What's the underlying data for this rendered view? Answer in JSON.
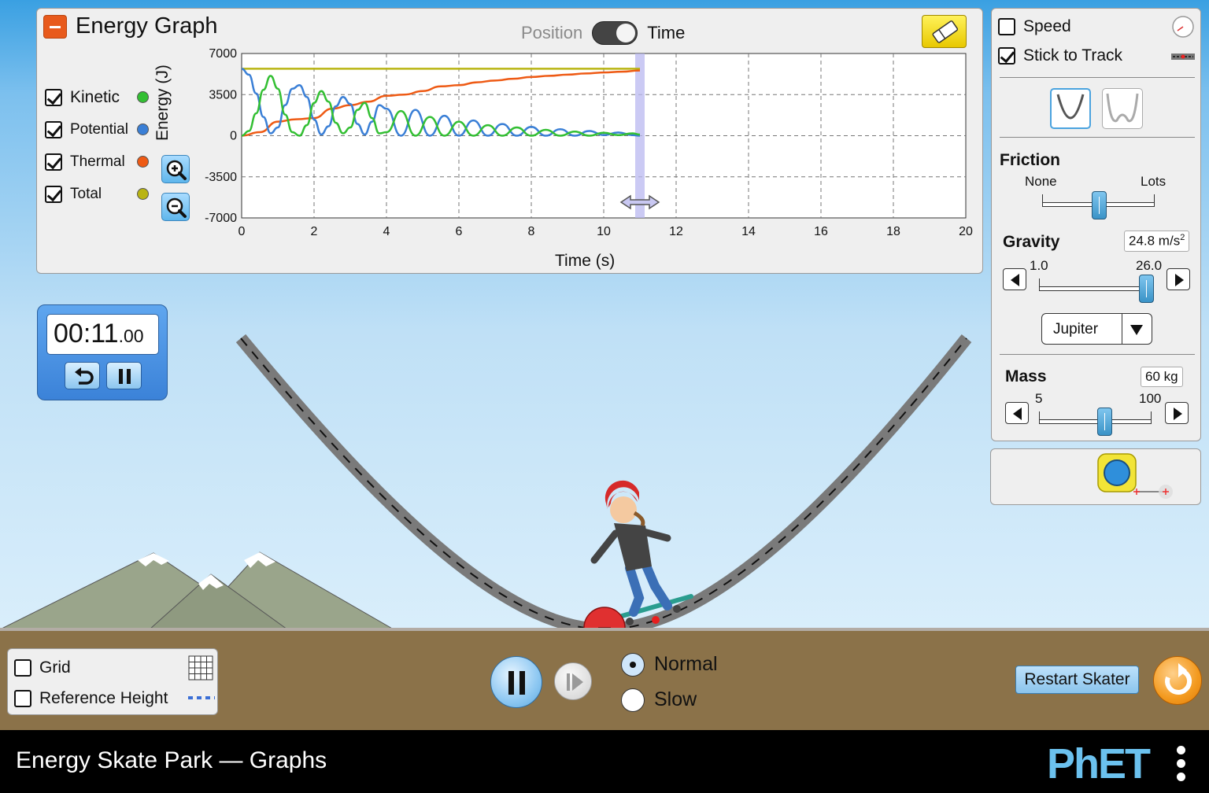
{
  "app": {
    "title": "Energy Skate Park — Graphs",
    "logo_text": "PhET"
  },
  "graph_panel": {
    "title": "Energy Graph",
    "toggle": {
      "left_label": "Position",
      "right_label": "Time",
      "selected": "Time"
    },
    "legend": [
      {
        "label": "Kinetic",
        "checked": true,
        "color": "#33bf33"
      },
      {
        "label": "Potential",
        "checked": true,
        "color": "#3a7fd6"
      },
      {
        "label": "Thermal",
        "checked": true,
        "color": "#ee5a14"
      },
      {
        "label": "Total",
        "checked": true,
        "color": "#b9b412"
      }
    ],
    "zoom_in_icon": "zoom-in-icon",
    "zoom_out_icon": "zoom-out-icon",
    "eraser_icon": "eraser-icon"
  },
  "chart_data": {
    "type": "line",
    "title": "",
    "xlabel": "Time (s)",
    "ylabel": "Energy (J)",
    "xlim": [
      0,
      20
    ],
    "ylim": [
      -7000,
      7000
    ],
    "x_ticks": [
      "0",
      "2",
      "4",
      "6",
      "8",
      "10",
      "12",
      "14",
      "16",
      "18",
      "20"
    ],
    "y_ticks": [
      "7000",
      "3500",
      "0",
      "-3500",
      "-7000"
    ],
    "grid": true,
    "cursor_time": 11.0,
    "series": [
      {
        "name": "Total",
        "color": "#b9b412",
        "x": [
          0,
          2,
          4,
          6,
          8,
          10,
          11
        ],
        "y": [
          5700,
          5700,
          5700,
          5700,
          5700,
          5700,
          5700
        ]
      },
      {
        "name": "Thermal",
        "color": "#ee5a14",
        "x": [
          0,
          0.5,
          1.0,
          1.5,
          2.0,
          2.5,
          3.0,
          3.5,
          4.0,
          4.5,
          5.0,
          5.5,
          6.0,
          6.5,
          7.0,
          7.5,
          8.0,
          8.5,
          9.0,
          9.5,
          10.0,
          10.5,
          11.0
        ],
        "y": [
          0,
          300,
          1200,
          1400,
          1500,
          2300,
          2600,
          2900,
          3400,
          3500,
          3800,
          4200,
          4300,
          4550,
          4700,
          4850,
          5000,
          5100,
          5200,
          5300,
          5380,
          5450,
          5550
        ]
      },
      {
        "name": "Potential",
        "color": "#3a7fd6",
        "x": [
          0,
          0.2,
          0.4,
          0.6,
          0.8,
          1.0,
          1.2,
          1.4,
          1.6,
          1.8,
          2.0,
          2.2,
          2.4,
          2.6,
          2.8,
          3.0,
          3.2,
          3.4,
          3.6,
          3.8,
          4.0,
          4.4,
          4.8,
          5.2,
          5.6,
          6.0,
          6.4,
          6.8,
          7.2,
          7.6,
          8.0,
          8.4,
          8.8,
          9.2,
          9.6,
          10.0,
          10.4,
          10.8,
          11.0
        ],
        "y": [
          5700,
          5200,
          3600,
          1600,
          200,
          700,
          2600,
          4000,
          4300,
          3300,
          1400,
          100,
          800,
          2500,
          3300,
          2700,
          1000,
          100,
          1200,
          2600,
          2300,
          0,
          2200,
          0,
          1700,
          0,
          1300,
          0,
          1000,
          0,
          750,
          0,
          550,
          0,
          400,
          50,
          280,
          50,
          0
        ]
      },
      {
        "name": "Kinetic",
        "color": "#33bf33",
        "x": [
          0,
          0.2,
          0.4,
          0.6,
          0.8,
          1.0,
          1.2,
          1.4,
          1.6,
          1.8,
          2.0,
          2.2,
          2.4,
          2.6,
          2.8,
          3.0,
          3.2,
          3.4,
          3.6,
          3.8,
          4.0,
          4.4,
          4.8,
          5.2,
          5.6,
          6.0,
          6.4,
          6.8,
          7.2,
          7.6,
          8.0,
          8.4,
          8.8,
          9.2,
          9.6,
          10.0,
          10.4,
          10.8,
          11.0
        ],
        "y": [
          0,
          400,
          1900,
          3900,
          5100,
          4000,
          1800,
          300,
          0,
          900,
          2800,
          3800,
          2900,
          1100,
          200,
          700,
          2200,
          2800,
          1500,
          200,
          300,
          2100,
          0,
          1600,
          0,
          1200,
          0,
          900,
          0,
          700,
          0,
          500,
          0,
          350,
          0,
          250,
          50,
          200,
          100
        ]
      }
    ]
  },
  "controls": {
    "speed": {
      "label": "Speed",
      "checked": false,
      "icon": "speedometer-icon"
    },
    "stick": {
      "label": "Stick to Track",
      "checked": true,
      "icon": "track-piece-icon"
    },
    "track_shapes": [
      "parabola-track-icon",
      "double-well-track-icon"
    ],
    "friction": {
      "title": "Friction",
      "min_label": "None",
      "max_label": "Lots",
      "value": 0.5
    },
    "gravity": {
      "title": "Gravity",
      "readout": "24.8 m/s",
      "unit_sup": "2",
      "min_label": "1.0",
      "max_label": "26.0",
      "value": 24.8,
      "min": 1.0,
      "max": 26.0
    },
    "planet": {
      "selected": "Jupiter"
    },
    "mass": {
      "title": "Mass",
      "readout": "60 kg",
      "min_label": "5",
      "max_label": "100",
      "value": 60,
      "min": 5,
      "max": 100
    },
    "tape_icon": "measuring-tape-icon"
  },
  "stopwatch": {
    "time_main": "00:11",
    "time_cs": ".00",
    "reset_icon": "reset-arrow-icon",
    "pause_icon": "pause-icon"
  },
  "view_options": {
    "grid": {
      "label": "Grid",
      "checked": false,
      "icon": "grid-icon"
    },
    "ref_height": {
      "label": "Reference Height",
      "checked": false,
      "icon": "dashed-line-icon"
    }
  },
  "playback": {
    "play_pause_icon": "pause-icon",
    "step_icon": "step-forward-icon",
    "speeds": [
      {
        "label": "Normal",
        "selected": true
      },
      {
        "label": "Slow",
        "selected": false
      }
    ],
    "restart_label": "Restart Skater",
    "reset_all_icon": "reset-all-icon"
  }
}
